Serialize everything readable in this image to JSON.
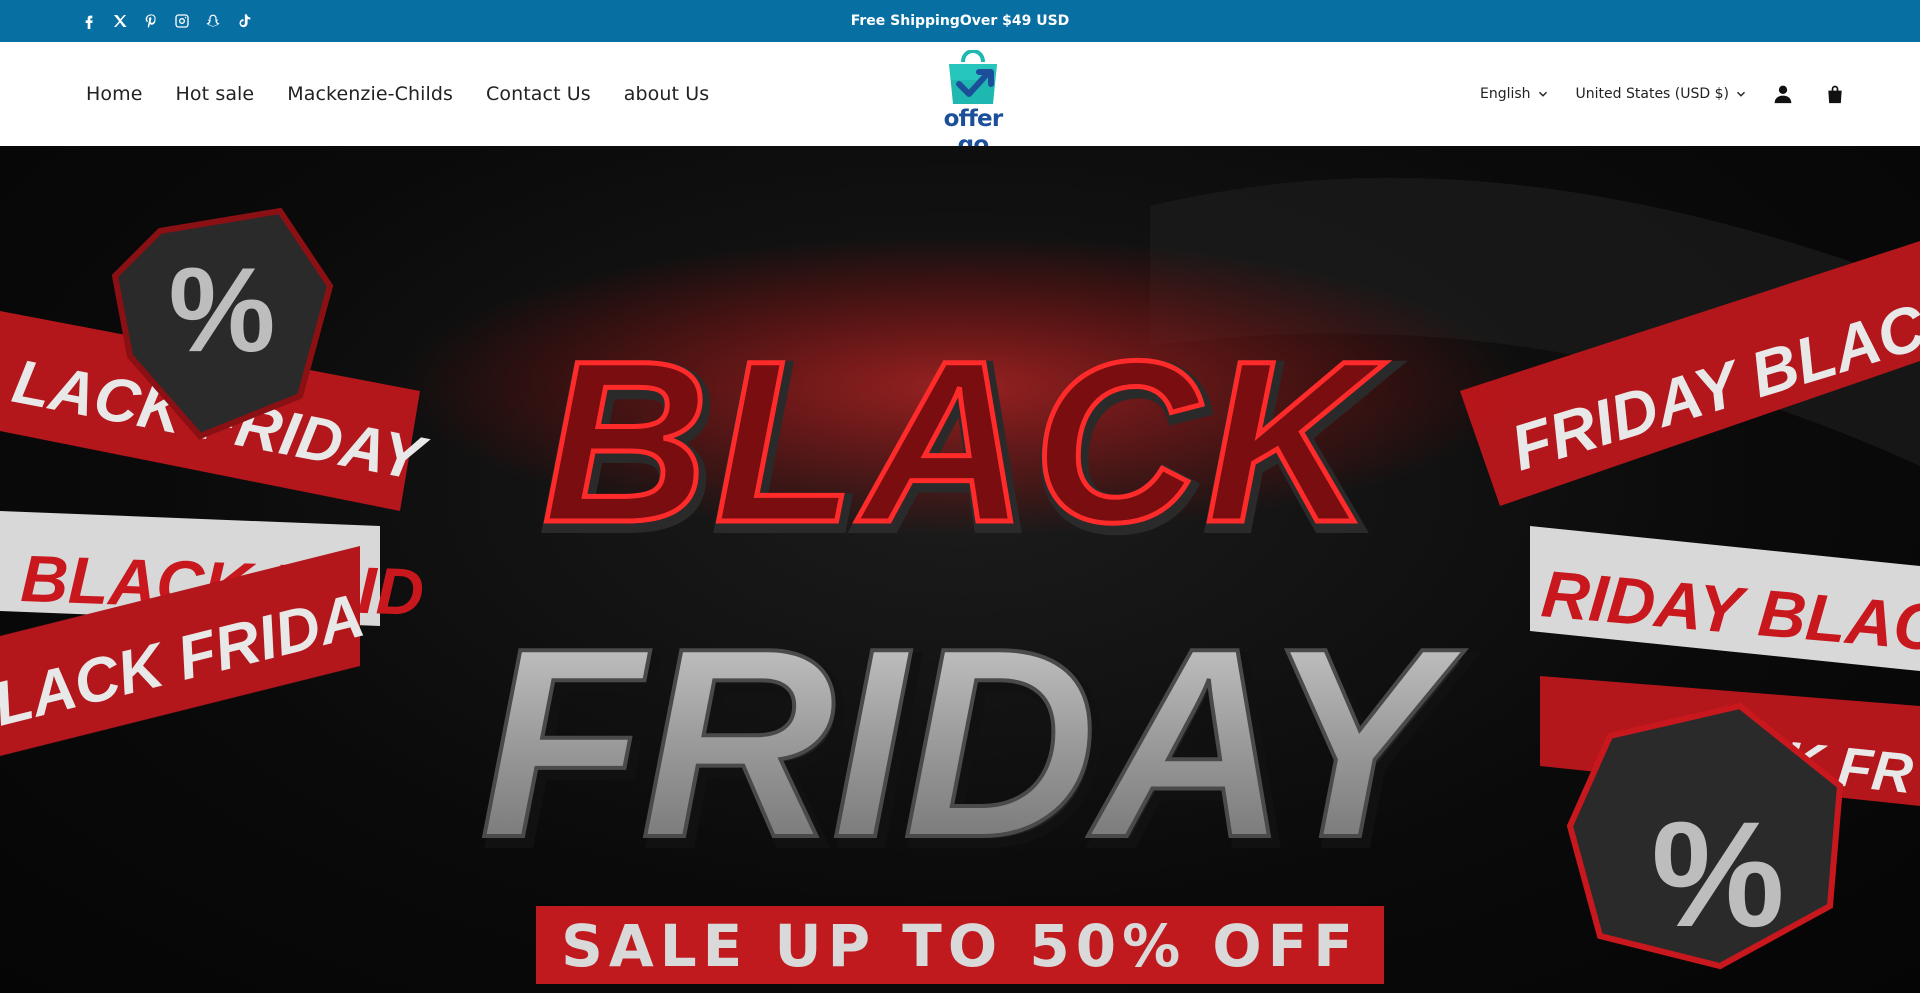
{
  "announcement": {
    "text": "Free ShippingOver $49 USD",
    "social_icons": [
      "facebook-icon",
      "x-twitter-icon",
      "pinterest-icon",
      "instagram-icon",
      "snapchat-icon",
      "tiktok-icon"
    ]
  },
  "nav": {
    "items": [
      {
        "label": "Home"
      },
      {
        "label": "Hot sale"
      },
      {
        "label": "Mackenzie-Childs"
      },
      {
        "label": "Contact Us"
      },
      {
        "label": "about Us"
      }
    ]
  },
  "logo": {
    "text": "offer go"
  },
  "header_right": {
    "language": "English",
    "currency": "United States (USD $)",
    "icons": [
      "account-icon",
      "cart-icon"
    ]
  },
  "hero": {
    "headline_top": "BLACK",
    "headline_bottom": "FRIDAY",
    "banner_text": "SALE UP TO 50% OFF",
    "ribbon_text_left_top": "LACK FRIDAY",
    "ribbon_text_right_top": "FRIDAY  BLAC",
    "ribbon_text_left_mid": "BLACK FRID",
    "ribbon_text_left_low": "LACK FRIDA",
    "ribbon_text_right_mid": "RIDAY  BLACK",
    "ribbon_text_right_low": "ACK FR",
    "badge_symbol": "%"
  },
  "colors": {
    "announcement_bg": "#086fa2",
    "logo_text": "#1c4f99",
    "logo_bag": "#1fb8b0",
    "hero_red": "#c8181e",
    "hero_silver": "#a9a9a9"
  }
}
